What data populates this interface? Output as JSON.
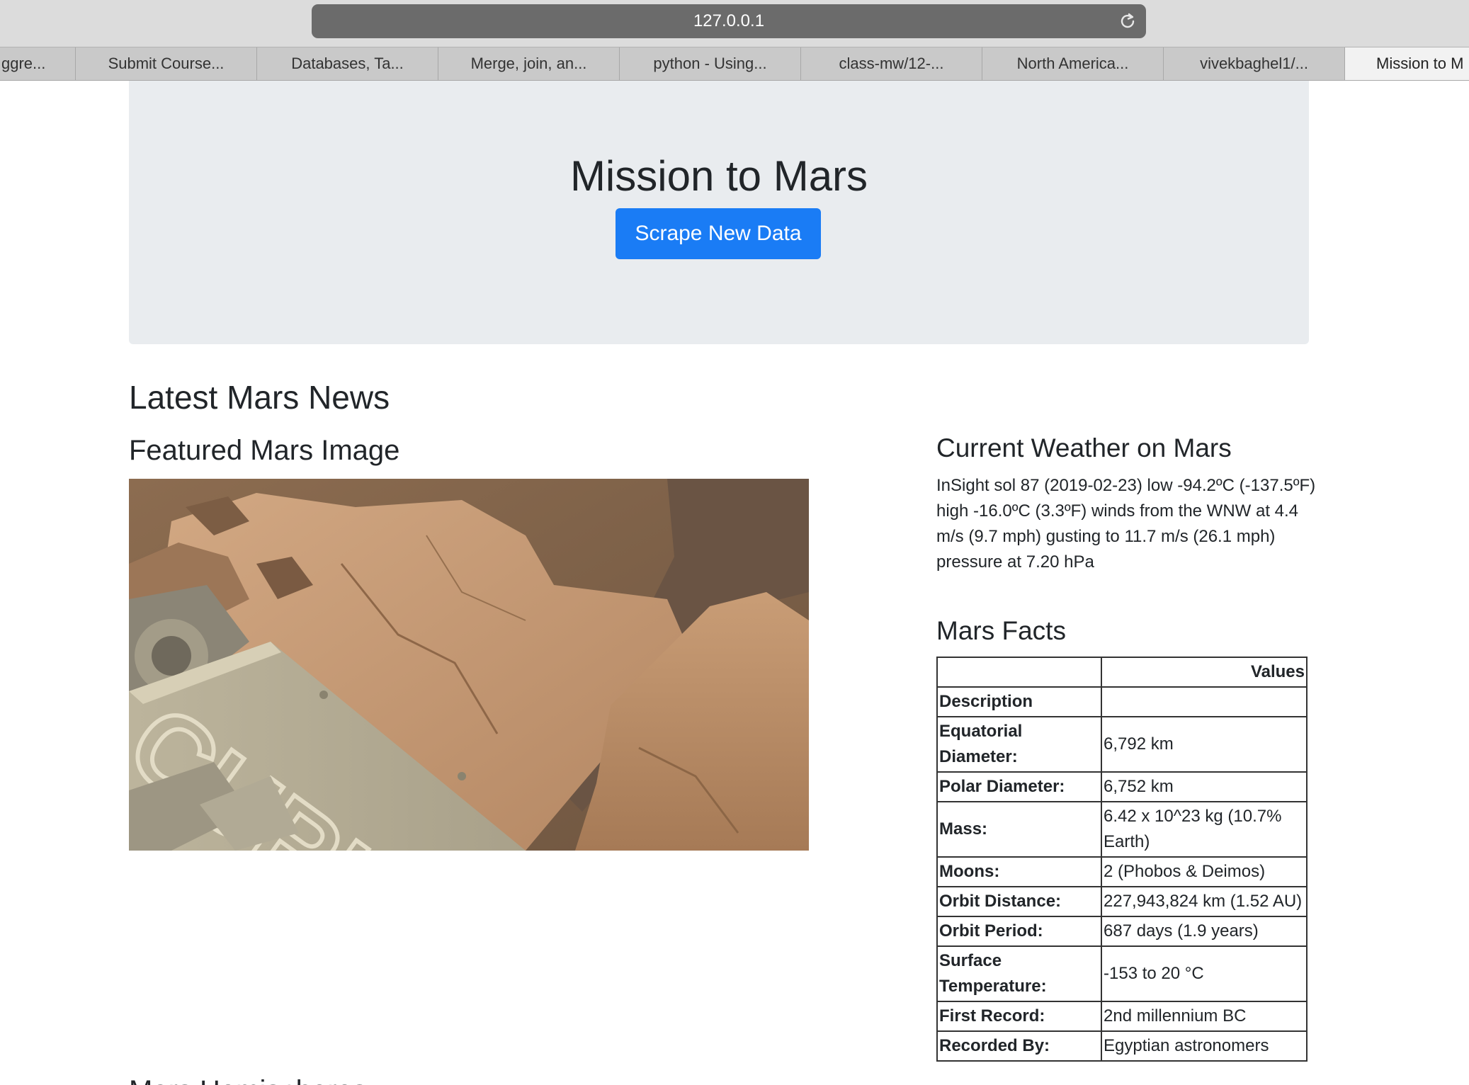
{
  "browser": {
    "address": "127.0.0.1",
    "tabs": [
      "ggre...",
      "Submit Course...",
      "Databases, Ta...",
      "Merge, join, an...",
      "python - Using...",
      "class-mw/12-...",
      "North America...",
      "vivekbaghel1/...",
      "Mission to M"
    ]
  },
  "header": {
    "title": "Mission to Mars",
    "scrape_button": "Scrape New Data"
  },
  "news": {
    "heading": "Latest Mars News"
  },
  "featured": {
    "heading": "Featured Mars Image",
    "image_text": "CURIOS"
  },
  "weather": {
    "heading": "Current Weather on Mars",
    "text": "InSight sol 87 (2019-02-23) low -94.2ºC (-137.5ºF) high -16.0ºC (3.3ºF) winds from the WNW at 4.4 m/s (9.7 mph) gusting to 11.7 m/s (26.1 mph) pressure at 7.20 hPa"
  },
  "facts": {
    "heading": "Mars Facts",
    "column_header": "Values",
    "index_label": "Description",
    "rows": [
      {
        "label": "Equatorial Diameter:",
        "value": "6,792 km"
      },
      {
        "label": "Polar Diameter:",
        "value": "6,752 km"
      },
      {
        "label": "Mass:",
        "value": "6.42 x 10^23 kg (10.7% Earth)"
      },
      {
        "label": "Moons:",
        "value": "2 (Phobos & Deimos)"
      },
      {
        "label": "Orbit Distance:",
        "value": "227,943,824 km (1.52 AU)"
      },
      {
        "label": "Orbit Period:",
        "value": "687 days (1.9 years)"
      },
      {
        "label": "Surface Temperature:",
        "value": "-153 to 20 °C"
      },
      {
        "label": "First Record:",
        "value": "2nd millennium BC"
      },
      {
        "label": "Recorded By:",
        "value": "Egyptian astronomers"
      }
    ]
  },
  "hemispheres": {
    "heading": "Mars Hemispheres"
  },
  "colors": {
    "jumbotron_bg": "#e9ecef",
    "button_primary": "#1a7cf5"
  }
}
